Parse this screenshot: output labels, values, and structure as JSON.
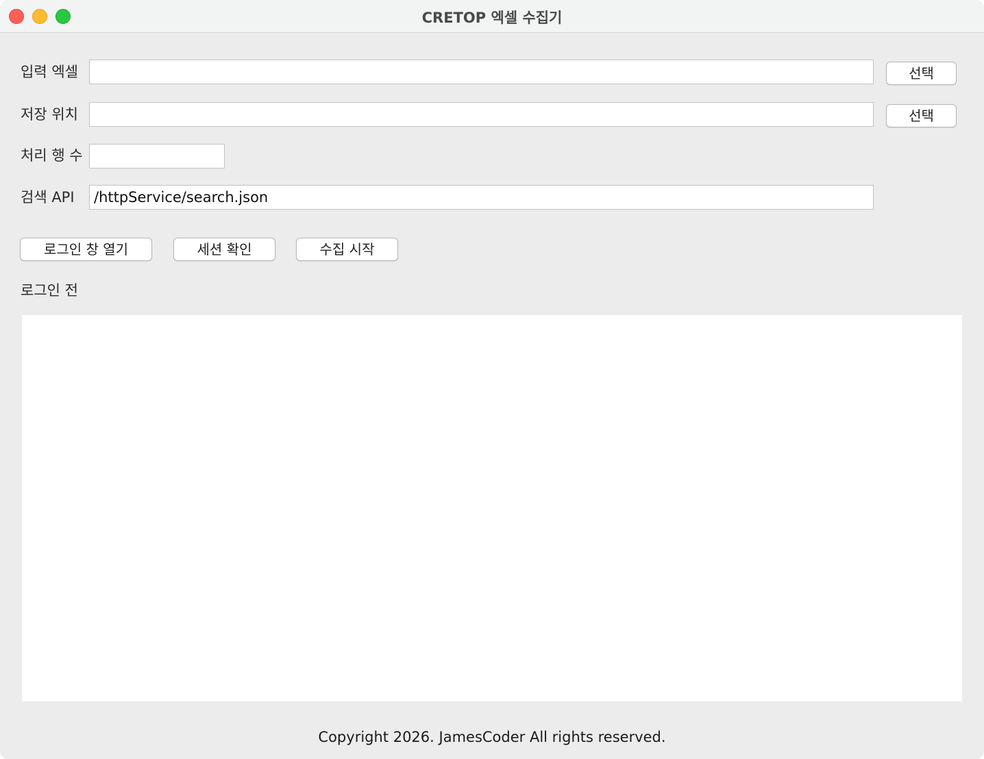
{
  "window": {
    "title": "CRETOP 엑셀 수집기"
  },
  "form": {
    "input_excel": {
      "label": "입력 엑셀",
      "value": "",
      "button_label": "선택"
    },
    "save_location": {
      "label": "저장 위치",
      "value": "",
      "button_label": "선택"
    },
    "row_count": {
      "label": "처리 행 수",
      "value": ""
    },
    "search_api": {
      "label": "검색 API",
      "value": "/httpService/search.json"
    }
  },
  "actions": {
    "open_login": "로그인 창 열기",
    "check_session": "세션 확인",
    "start_collect": "수집 시작"
  },
  "status": {
    "text": "로그인 전"
  },
  "log": {
    "content": ""
  },
  "footer": {
    "text": "Copyright 2026. JamesCoder All rights reserved."
  }
}
